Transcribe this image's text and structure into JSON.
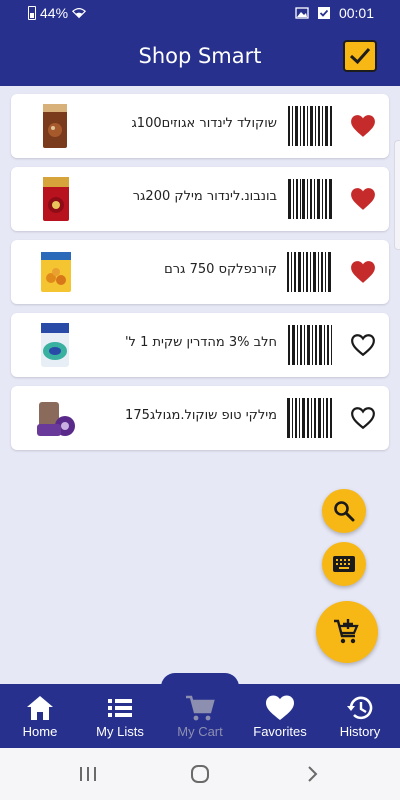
{
  "status_bar": {
    "battery": "44%",
    "time": "00:01"
  },
  "app_bar": {
    "title": "Shop Smart"
  },
  "products": [
    {
      "name": "שוקולד לינדור אגוזים100ג",
      "favorite": true
    },
    {
      "name": "בונבונ.לינדור מילק 200גר",
      "favorite": true
    },
    {
      "name": "קורנפלקס 750 גרם",
      "favorite": true
    },
    {
      "name": "חלב 3% מהדרין שקית 1 ל'",
      "favorite": false
    },
    {
      "name": "מילקי טופ שוקול.מגולג175",
      "favorite": false
    }
  ],
  "fabs": {
    "search": "search-icon",
    "keyboard": "keyboard-icon",
    "add_to_cart": "add-shopping-cart-icon"
  },
  "bottom_nav": [
    {
      "label": "Home",
      "icon": "home-icon",
      "active": false
    },
    {
      "label": "My Lists",
      "icon": "list-icon",
      "active": false
    },
    {
      "label": "My Cart",
      "icon": "cart-icon",
      "active": true
    },
    {
      "label": "Favorites",
      "icon": "heart-icon",
      "active": false
    },
    {
      "label": "History",
      "icon": "history-icon",
      "active": false
    }
  ],
  "colors": {
    "primary": "#27318d",
    "accent": "#f7b715",
    "heart": "#c62b2b",
    "background": "#e7e8f6"
  }
}
